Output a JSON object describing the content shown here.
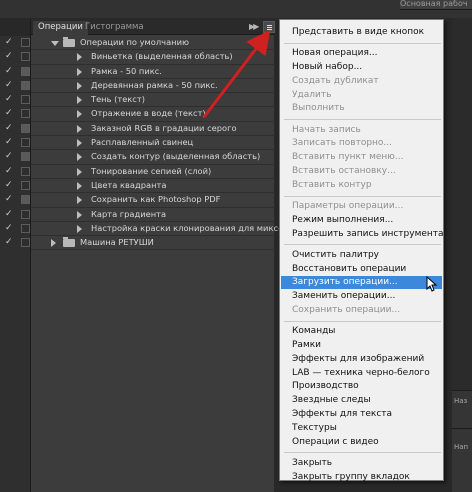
{
  "top_right_label": "Основная рабоч",
  "panel": {
    "tabs": [
      "Операции",
      "Гистограмма"
    ],
    "collapse_icon": "double-chevron-right-icon",
    "menu_icon": "panel-menu-icon"
  },
  "actions": [
    {
      "label": "Операции по умолчанию",
      "level": 0,
      "type": "set",
      "open": true,
      "checked": true,
      "box": false
    },
    {
      "label": "Виньетка (выделенная область)",
      "level": 1,
      "type": "action",
      "checked": true,
      "box": false
    },
    {
      "label": "Рамка - 50 пикс.",
      "level": 1,
      "type": "action",
      "checked": true,
      "box": true
    },
    {
      "label": "Деревянная рамка - 50 пикс.",
      "level": 1,
      "type": "action",
      "checked": true,
      "box": true
    },
    {
      "label": "Тень (текст)",
      "level": 1,
      "type": "action",
      "checked": true,
      "box": false
    },
    {
      "label": "Отражение в воде (текст)",
      "level": 1,
      "type": "action",
      "checked": true,
      "box": false
    },
    {
      "label": "Заказной RGB в градации серого",
      "level": 1,
      "type": "action",
      "checked": true,
      "box": true
    },
    {
      "label": "Расплавленный свинец",
      "level": 1,
      "type": "action",
      "checked": true,
      "box": false
    },
    {
      "label": "Создать контур (выделенная область)",
      "level": 1,
      "type": "action",
      "checked": true,
      "box": true
    },
    {
      "label": "Тонирование сепией (слой)",
      "level": 1,
      "type": "action",
      "checked": true,
      "box": false
    },
    {
      "label": "Цвета квадранта",
      "level": 1,
      "type": "action",
      "checked": true,
      "box": false
    },
    {
      "label": "Сохранить как Photoshop PDF",
      "level": 1,
      "type": "action",
      "checked": true,
      "box": true
    },
    {
      "label": "Карта градиента",
      "level": 1,
      "type": "action",
      "checked": true,
      "box": false
    },
    {
      "label": "Настройка краски клонирования для микс-кисти",
      "level": 1,
      "type": "action",
      "checked": true,
      "box": false
    },
    {
      "label": "Машина РЕТУШИ",
      "level": 0,
      "type": "set",
      "open": false,
      "checked": true,
      "box": false
    }
  ],
  "menu": {
    "items": [
      {
        "label": "Представить в виде кнопок",
        "state": "normal",
        "sep_after": true
      },
      {
        "label": "Новая операция...",
        "state": "normal"
      },
      {
        "label": "Новый набор...",
        "state": "normal"
      },
      {
        "label": "Создать дубликат",
        "state": "disabled"
      },
      {
        "label": "Удалить",
        "state": "disabled"
      },
      {
        "label": "Выполнить",
        "state": "disabled",
        "sep_after": true
      },
      {
        "label": "Начать запись",
        "state": "disabled"
      },
      {
        "label": "Записать повторно...",
        "state": "disabled"
      },
      {
        "label": "Вставить пункт меню...",
        "state": "disabled"
      },
      {
        "label": "Вставить остановку...",
        "state": "disabled"
      },
      {
        "label": "Вставить контур",
        "state": "disabled",
        "sep_after": true
      },
      {
        "label": "Параметры операции...",
        "state": "disabled"
      },
      {
        "label": "Режим выполнения...",
        "state": "normal"
      },
      {
        "label": "Разрешить запись инструмента",
        "state": "normal",
        "sep_after": true
      },
      {
        "label": "Очистить палитру",
        "state": "normal"
      },
      {
        "label": "Восстановить операции",
        "state": "normal"
      },
      {
        "label": "Загрузить операции...",
        "state": "highlighted"
      },
      {
        "label": "Заменить операции...",
        "state": "normal"
      },
      {
        "label": "Сохранить операции...",
        "state": "disabled",
        "sep_after": true
      },
      {
        "label": "Команды",
        "state": "normal"
      },
      {
        "label": "Рамки",
        "state": "normal"
      },
      {
        "label": "Эффекты для изображений",
        "state": "normal"
      },
      {
        "label": "LAB — техника черно-белого",
        "state": "normal"
      },
      {
        "label": "Производство",
        "state": "normal"
      },
      {
        "label": "Звездные следы",
        "state": "normal"
      },
      {
        "label": "Эффекты для текста",
        "state": "normal"
      },
      {
        "label": "Текстуры",
        "state": "normal"
      },
      {
        "label": "Операции с видео",
        "state": "normal",
        "sep_after": true
      },
      {
        "label": "Закрыть",
        "state": "normal"
      },
      {
        "label": "Закрыть группу вкладок",
        "state": "normal"
      }
    ]
  },
  "right_strip_labels": [
    "Наз",
    "Нап"
  ],
  "colors": {
    "highlight": "#3c88da",
    "arrow": "#d02020"
  }
}
